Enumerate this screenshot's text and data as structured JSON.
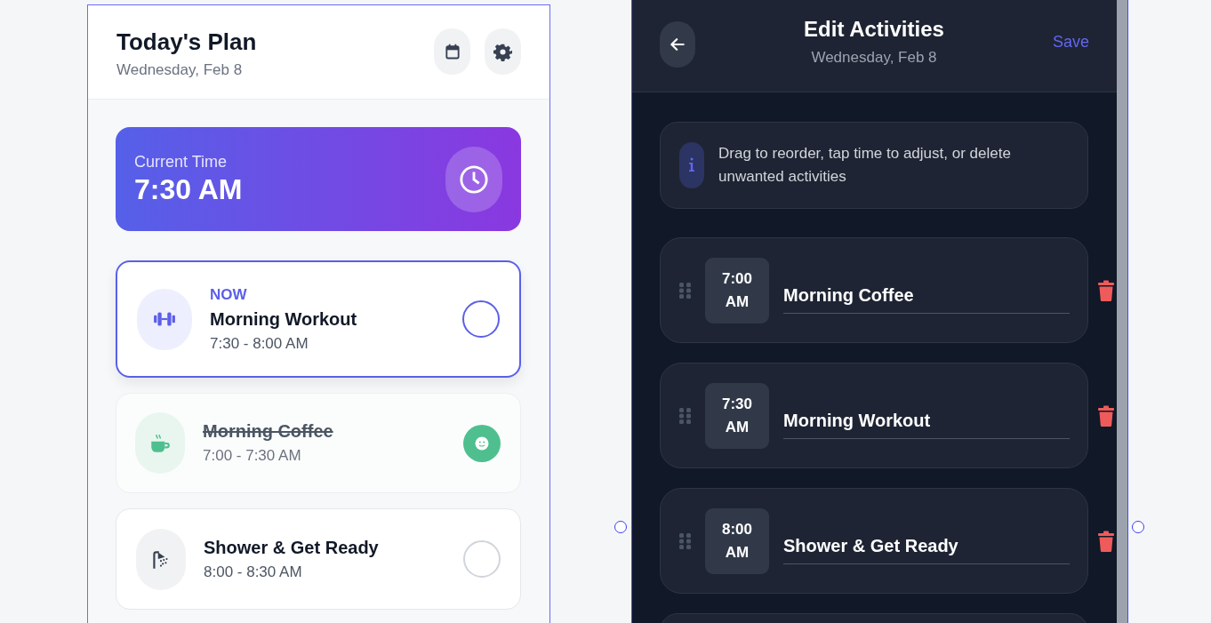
{
  "plan": {
    "title": "Today's Plan",
    "date": "Wednesday, Feb 8",
    "current_time": {
      "label": "Current Time",
      "time": "7:30 AM"
    },
    "activities": [
      {
        "kind": "workout",
        "current": true,
        "completed": false,
        "badge": "NOW",
        "name": "Morning Workout",
        "time": "7:30 - 8:00 AM"
      },
      {
        "kind": "coffee",
        "current": false,
        "completed": true,
        "name": "Morning Coffee",
        "time": "7:00 - 7:30 AM"
      },
      {
        "kind": "shower",
        "current": false,
        "completed": false,
        "name": "Shower & Get Ready",
        "time": "8:00 - 8:30 AM"
      }
    ]
  },
  "editor": {
    "title": "Edit Activities",
    "date": "Wednesday, Feb 8",
    "save": "Save",
    "info": "Drag to reorder, tap time to adjust, or delete unwanted activities",
    "items": [
      {
        "time": "7:00 AM",
        "name": "Morning Coffee"
      },
      {
        "time": "7:30 AM",
        "name": "Morning Workout"
      },
      {
        "time": "8:00 AM",
        "name": "Shower & Get Ready"
      }
    ]
  }
}
